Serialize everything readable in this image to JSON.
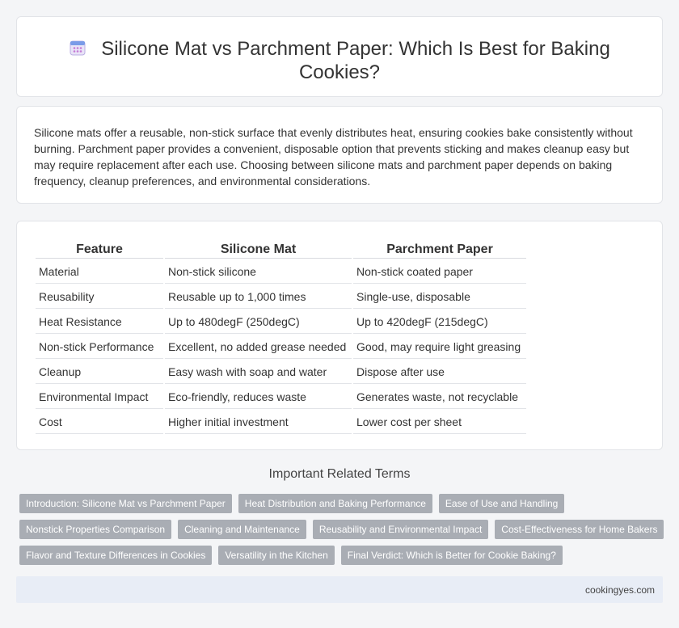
{
  "header": {
    "title": "Silicone Mat vs Parchment Paper: Which Is Best for Baking Cookies?",
    "icon": "calendar-icon"
  },
  "intro": {
    "text": "Silicone mats offer a reusable, non-stick surface that evenly distributes heat, ensuring cookies bake consistently without burning. Parchment paper provides a convenient, disposable option that prevents sticking and makes cleanup easy but may require replacement after each use. Choosing between silicone mats and parchment paper depends on baking frequency, cleanup preferences, and environmental considerations."
  },
  "table": {
    "headers": [
      "Feature",
      "Silicone Mat",
      "Parchment Paper"
    ],
    "rows": [
      [
        "Material",
        "Non-stick silicone",
        "Non-stick coated paper"
      ],
      [
        "Reusability",
        "Reusable up to 1,000 times",
        "Single-use, disposable"
      ],
      [
        "Heat Resistance",
        "Up to 480degF (250degC)",
        "Up to 420degF (215degC)"
      ],
      [
        "Non-stick Performance",
        "Excellent, no added grease needed",
        "Good, may require light greasing"
      ],
      [
        "Cleanup",
        "Easy wash with soap and water",
        "Dispose after use"
      ],
      [
        "Environmental Impact",
        "Eco-friendly, reduces waste",
        "Generates waste, not recyclable"
      ],
      [
        "Cost",
        "Higher initial investment",
        "Lower cost per sheet"
      ]
    ]
  },
  "related": {
    "title": "Important Related Terms",
    "tag_rows": [
      [
        "Introduction: Silicone Mat vs Parchment Paper",
        "Heat Distribution and Baking Performance",
        "Ease of Use and Handling"
      ],
      [
        "Nonstick Properties Comparison",
        "Cleaning and Maintenance",
        "Reusability and Environmental Impact",
        "Cost-Effectiveness for Home Bakers"
      ],
      [
        "Flavor and Texture Differences in Cookies",
        "Versatility in the Kitchen",
        "Final Verdict: Which is Better for Cookie Baking?"
      ]
    ]
  },
  "footer": {
    "site": "cookingyes.com"
  },
  "colors": {
    "background": "#f4f5f7",
    "card": "#ffffff",
    "tag": "#a9adb4",
    "footer": "#e8edf6"
  }
}
